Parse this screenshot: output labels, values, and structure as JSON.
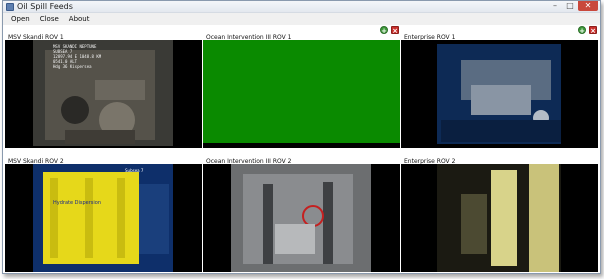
{
  "window": {
    "title": "Oil Spill Feeds"
  },
  "menu": {
    "items": [
      "Open",
      "Close",
      "About"
    ]
  },
  "feeds": [
    {
      "name": "MSV Skandi ROV 1"
    },
    {
      "name": "Ocean Intervention III ROV 1"
    },
    {
      "name": "Enterprise ROV 1"
    },
    {
      "name": "MSV Skandi ROV 2"
    },
    {
      "name": "Ocean Intervention III ROV 2"
    },
    {
      "name": "Enterprise ROV 2"
    }
  ],
  "feed_overlay": {
    "lines": [
      "MSV SKANDI NEPTUNE",
      "SUBSEA 7",
      "12897.94  E 1048.8 KM",
      "0541.0  ALT",
      "Hdg 36  Kispersea"
    ]
  },
  "feed_labels": {
    "panel": "Hydrate Dispersion",
    "tag": "Subsea 7"
  },
  "icons": {
    "add": "plus-circle-icon",
    "remove": "close-square-icon"
  },
  "colors": {
    "feed_green": "#0a8a00",
    "feed_black": "#000000",
    "close_red": "#c9483c"
  }
}
